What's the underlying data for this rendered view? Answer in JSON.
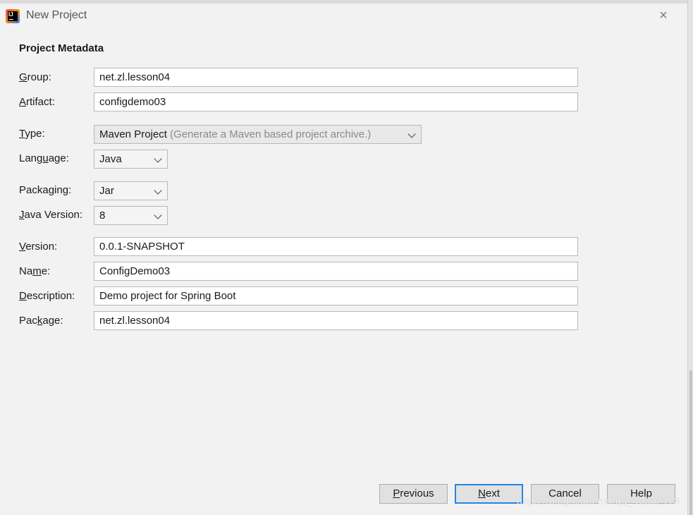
{
  "window": {
    "title": "New Project",
    "close_glyph": "×"
  },
  "section": {
    "title": "Project Metadata"
  },
  "fields": {
    "group": {
      "label_u": "G",
      "label_rest": "roup:",
      "value": "net.zl.lesson04"
    },
    "artifact": {
      "label_pre": "",
      "label_u": "A",
      "label_rest": "rtifact:",
      "value": "configdemo03"
    },
    "type": {
      "label_u": "T",
      "label_rest": "ype:",
      "value": "Maven Project",
      "hint": "(Generate a Maven based project archive.)"
    },
    "language": {
      "label_pre": "Lang",
      "label_u": "u",
      "label_rest": "age:",
      "value": "Java"
    },
    "packaging": {
      "label_pre": "Packa",
      "label_u": "g",
      "label_rest": "ing:",
      "value": "Jar"
    },
    "java_version": {
      "label_u": "J",
      "label_rest": "ava Version:",
      "value": "8"
    },
    "version": {
      "label_u": "V",
      "label_rest": "ersion:",
      "value": "0.0.1-SNAPSHOT"
    },
    "name": {
      "label_pre": "Na",
      "label_u": "m",
      "label_rest": "e:",
      "value": "ConfigDemo03"
    },
    "description": {
      "label_u": "D",
      "label_rest": "escription:",
      "value": "Demo project for Spring Boot"
    },
    "package": {
      "label_pre": "Pac",
      "label_u": "k",
      "label_rest": "age:",
      "value": "net.zl.lesson04"
    }
  },
  "buttons": {
    "previous": {
      "u": "P",
      "rest": "revious"
    },
    "next": {
      "u": "N",
      "rest": "ext"
    },
    "cancel": {
      "label": "Cancel"
    },
    "help": {
      "label": "Help"
    }
  },
  "watermark": "https://blog.csdn.net/qq_40302173",
  "colors": {
    "accent": "#1e88e5",
    "background": "#f2f2f2"
  },
  "icons": {
    "app": "intellij-idea-icon",
    "close": "close-icon",
    "dropdown": "chevron-down-icon"
  }
}
